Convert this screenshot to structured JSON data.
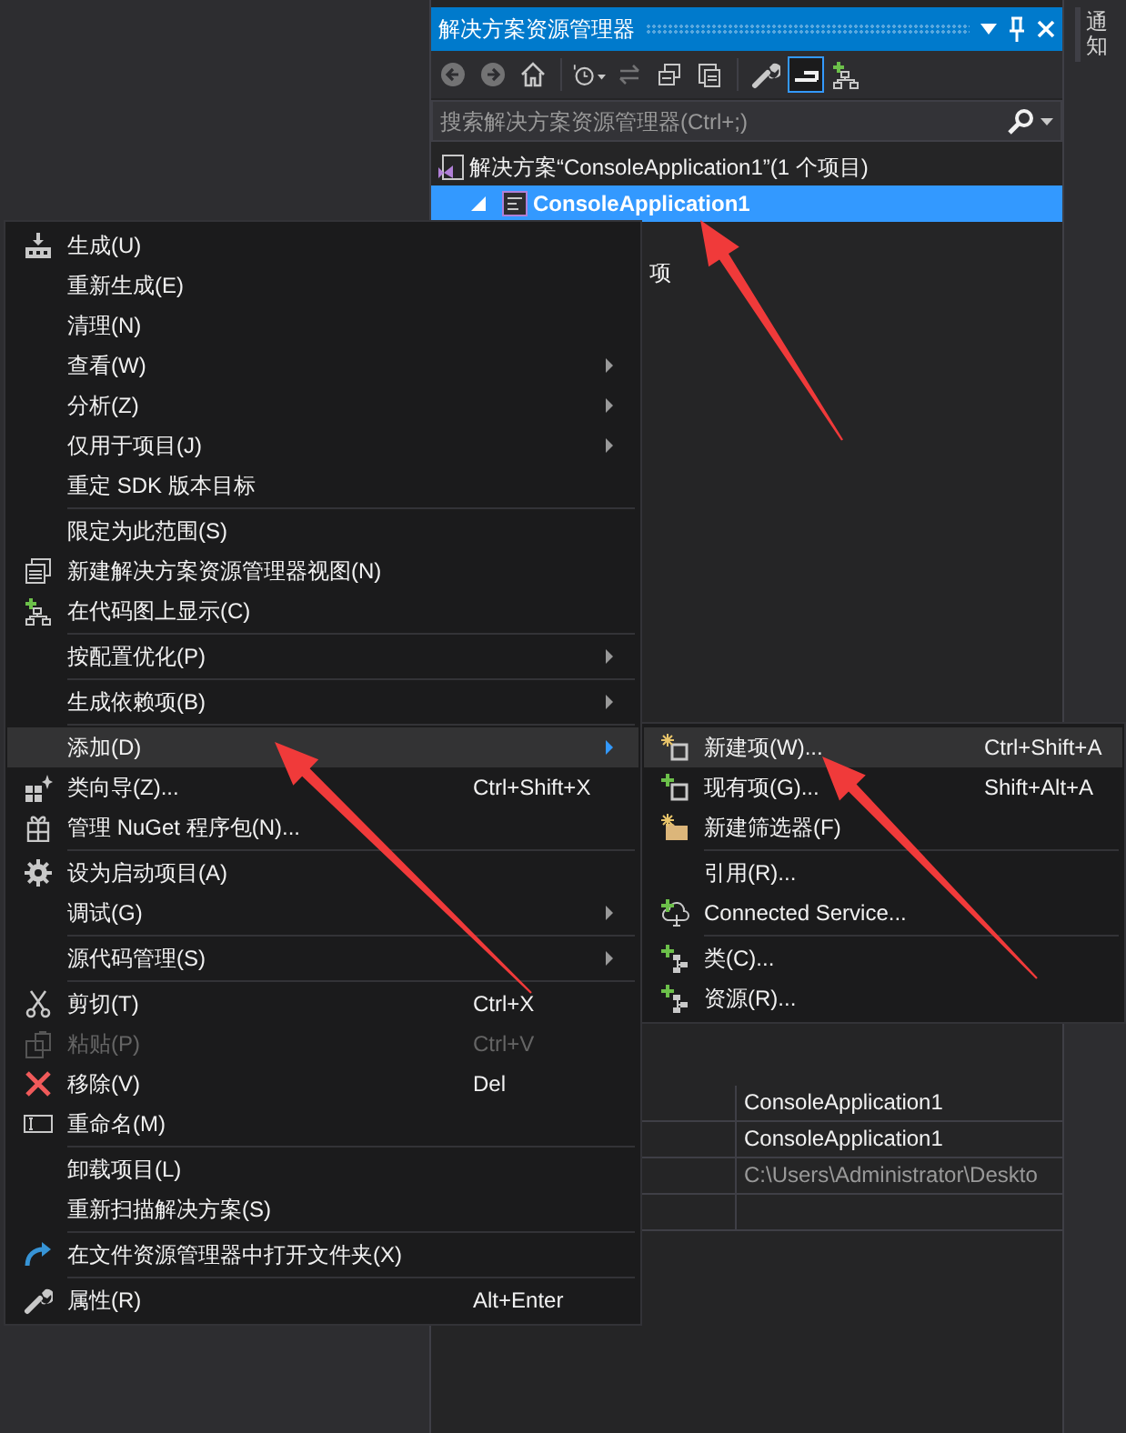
{
  "explorer": {
    "title": "解决方案资源管理器",
    "toolbar": [
      {
        "kind": "button",
        "disabled": true,
        "selected": false
      },
      {
        "kind": "button",
        "disabled": true,
        "selected": false
      },
      {
        "kind": "button",
        "disabled": false,
        "selected": false
      },
      {
        "kind": "separator"
      },
      {
        "kind": "button",
        "disabled": false,
        "selected": false
      },
      {
        "kind": "button",
        "disabled": true,
        "selected": false
      },
      {
        "kind": "button",
        "disabled": false,
        "selected": false
      },
      {
        "kind": "button",
        "disabled": false,
        "selected": false
      },
      {
        "kind": "separator"
      },
      {
        "kind": "button",
        "disabled": false,
        "selected": false
      },
      {
        "kind": "button",
        "disabled": false,
        "selected": true
      },
      {
        "kind": "button",
        "disabled": false,
        "selected": false
      }
    ],
    "search": {
      "placeholder": "搜索解决方案资源管理器(Ctrl+;)"
    },
    "tree": [
      {
        "label": "解决方案“ConsoleApplication1”(1 个项目)",
        "selected": false,
        "children": [
          {
            "label": "ConsoleApplication1",
            "selected": true,
            "expanded": true,
            "children": [
              {
                "label": "项",
                "selected": false
              }
            ]
          }
        ]
      }
    ],
    "properties": [
      "ConsoleApplication1",
      "ConsoleApplication1",
      "C:\\Users\\Administrator\\Deskto"
    ]
  },
  "notifications_tab": {
    "label": "通知"
  },
  "context_menu": {
    "items": [
      {
        "kind": "item",
        "label": "生成(U)",
        "submenu": false,
        "disabled": false,
        "selected": false
      },
      {
        "kind": "item",
        "label": "重新生成(E)",
        "submenu": false,
        "disabled": false,
        "selected": false
      },
      {
        "kind": "item",
        "label": "清理(N)",
        "submenu": false,
        "disabled": false,
        "selected": false
      },
      {
        "kind": "item",
        "label": "查看(W)",
        "submenu": true,
        "disabled": false,
        "selected": false
      },
      {
        "kind": "item",
        "label": "分析(Z)",
        "submenu": true,
        "disabled": false,
        "selected": false
      },
      {
        "kind": "item",
        "label": "仅用于项目(J)",
        "submenu": true,
        "disabled": false,
        "selected": false
      },
      {
        "kind": "item",
        "label": "重定 SDK 版本目标",
        "submenu": false,
        "disabled": false,
        "selected": false
      },
      {
        "kind": "separator"
      },
      {
        "kind": "item",
        "label": "限定为此范围(S)",
        "submenu": false,
        "disabled": false,
        "selected": false
      },
      {
        "kind": "item",
        "label": "新建解决方案资源管理器视图(N)",
        "submenu": false,
        "disabled": false,
        "selected": false
      },
      {
        "kind": "item",
        "label": "在代码图上显示(C)",
        "submenu": false,
        "disabled": false,
        "selected": false
      },
      {
        "kind": "separator"
      },
      {
        "kind": "item",
        "label": "按配置优化(P)",
        "submenu": true,
        "disabled": false,
        "selected": false
      },
      {
        "kind": "separator"
      },
      {
        "kind": "item",
        "label": "生成依赖项(B)",
        "submenu": true,
        "disabled": false,
        "selected": false
      },
      {
        "kind": "separator"
      },
      {
        "kind": "item",
        "label": "添加(D)",
        "submenu": true,
        "disabled": false,
        "selected": true
      },
      {
        "kind": "item",
        "label": "类向导(Z)...",
        "shortcut": "Ctrl+Shift+X",
        "submenu": false,
        "disabled": false,
        "selected": false
      },
      {
        "kind": "item",
        "label": "管理 NuGet 程序包(N)...",
        "submenu": false,
        "disabled": false,
        "selected": false
      },
      {
        "kind": "separator"
      },
      {
        "kind": "item",
        "label": "设为启动项目(A)",
        "submenu": false,
        "disabled": false,
        "selected": false
      },
      {
        "kind": "item",
        "label": "调试(G)",
        "submenu": true,
        "disabled": false,
        "selected": false
      },
      {
        "kind": "separator"
      },
      {
        "kind": "item",
        "label": "源代码管理(S)",
        "submenu": true,
        "disabled": false,
        "selected": false
      },
      {
        "kind": "separator"
      },
      {
        "kind": "item",
        "label": "剪切(T)",
        "shortcut": "Ctrl+X",
        "submenu": false,
        "disabled": false,
        "selected": false
      },
      {
        "kind": "item",
        "label": "粘贴(P)",
        "shortcut": "Ctrl+V",
        "submenu": false,
        "disabled": true,
        "selected": false
      },
      {
        "kind": "item",
        "label": "移除(V)",
        "shortcut": "Del",
        "submenu": false,
        "disabled": false,
        "selected": false
      },
      {
        "kind": "item",
        "label": "重命名(M)",
        "submenu": false,
        "disabled": false,
        "selected": false
      },
      {
        "kind": "separator"
      },
      {
        "kind": "item",
        "label": "卸载项目(L)",
        "submenu": false,
        "disabled": false,
        "selected": false
      },
      {
        "kind": "item",
        "label": "重新扫描解决方案(S)",
        "submenu": false,
        "disabled": false,
        "selected": false
      },
      {
        "kind": "separator"
      },
      {
        "kind": "item",
        "label": "在文件资源管理器中打开文件夹(X)",
        "submenu": false,
        "disabled": false,
        "selected": false
      },
      {
        "kind": "separator"
      },
      {
        "kind": "item",
        "label": "属性(R)",
        "shortcut": "Alt+Enter",
        "submenu": false,
        "disabled": false,
        "selected": false
      }
    ]
  },
  "submenu": {
    "items": [
      {
        "kind": "item",
        "label": "新建项(W)...",
        "shortcut": "Ctrl+Shift+A",
        "disabled": false,
        "selected": true
      },
      {
        "kind": "item",
        "label": "现有项(G)...",
        "shortcut": "Shift+Alt+A",
        "disabled": false,
        "selected": false
      },
      {
        "kind": "item",
        "label": "新建筛选器(F)",
        "disabled": false,
        "selected": false
      },
      {
        "kind": "separator"
      },
      {
        "kind": "item",
        "label": "引用(R)...",
        "disabled": false,
        "selected": false
      },
      {
        "kind": "item",
        "label": "Connected Service...",
        "disabled": false,
        "selected": false
      },
      {
        "kind": "separator"
      },
      {
        "kind": "item",
        "label": "类(C)...",
        "disabled": false,
        "selected": false
      },
      {
        "kind": "item",
        "label": "资源(R)...",
        "disabled": false,
        "selected": false
      }
    ]
  }
}
